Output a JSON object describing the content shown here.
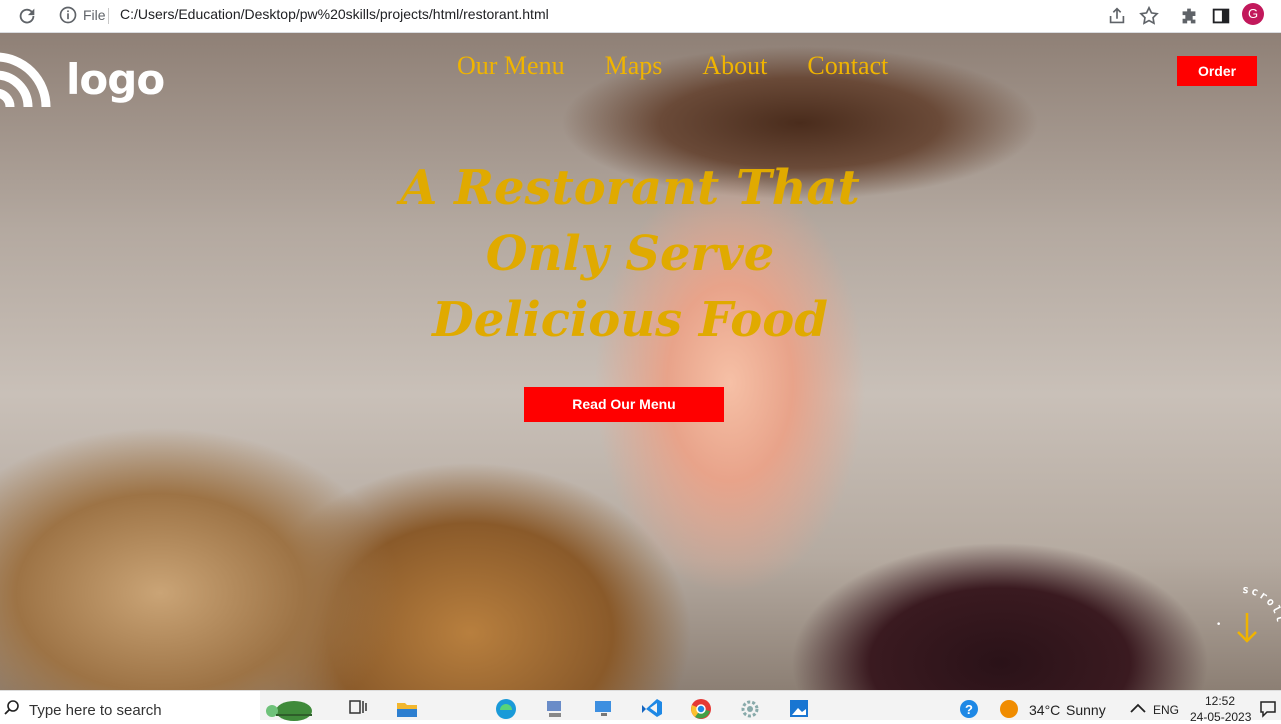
{
  "browser": {
    "scheme_label": "File",
    "url": "C:/Users/Education/Desktop/pw%20skills/projects/html/restorant.html",
    "profile_initial": "G"
  },
  "site": {
    "logo_text": "logo",
    "nav": [
      "Our Menu",
      "Maps",
      "About",
      "Contact"
    ],
    "order_label": "Order",
    "headline": [
      "A Restorant That",
      "Only Serve",
      "Delicious Food"
    ],
    "cta_label": "Read Our Menu",
    "scroll_label": "scroll",
    "colors": {
      "accent": "#e0aa00",
      "button": "#ff0000",
      "nav": "#f0b400"
    }
  },
  "taskbar": {
    "search_placeholder": "Type here to search",
    "weather_temp": "34°C",
    "weather_text": "Sunny",
    "language": "ENG",
    "time": "12:52",
    "date": "24-05-2023"
  }
}
